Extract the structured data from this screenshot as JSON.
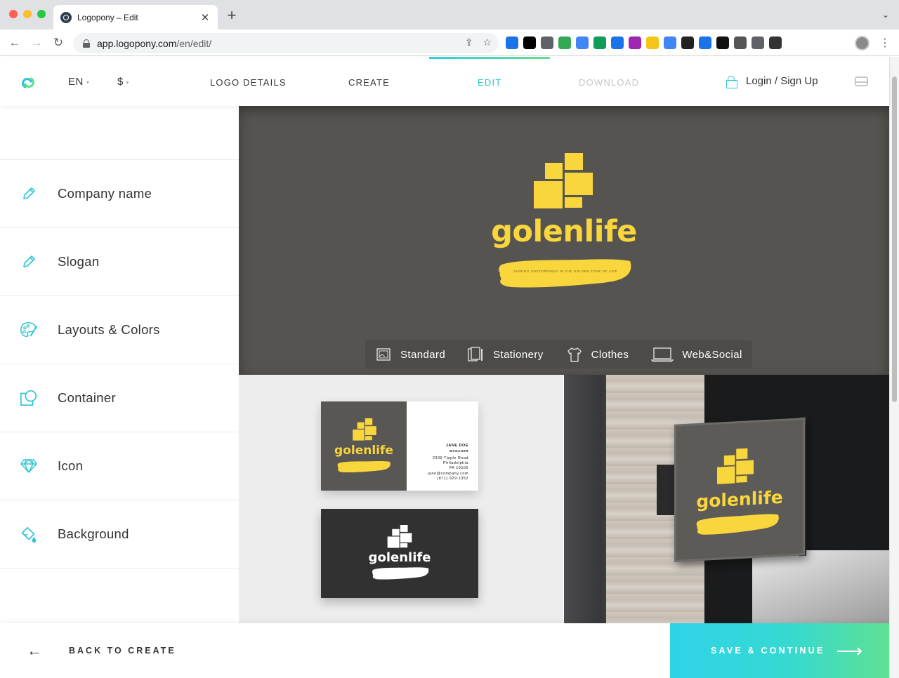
{
  "browser": {
    "tab_title": "Logopony – Edit",
    "tab_close": "✕",
    "new_tab": "+",
    "tab_menu": "⌄",
    "url_host": "app.logopony.com",
    "url_path": "/en/edit/",
    "back": "←",
    "forward": "→",
    "reload": "↻",
    "share": "⇪",
    "star": "☆",
    "kebab": "⋮",
    "extension_colors": [
      "#1a73e8",
      "#000000",
      "#5f6368",
      "#34a853",
      "#4285f4",
      "#0f9d58",
      "#1a73e8",
      "#9c27b0",
      "#f5c518",
      "#4285f4",
      "#222222",
      "#1a73e8",
      "#111111",
      "#555555",
      "#5f6368",
      "#333333"
    ]
  },
  "header": {
    "language": "EN",
    "currency": "$",
    "caret": "▾",
    "steps": [
      {
        "label": "LOGO DETAILS",
        "state": "done"
      },
      {
        "label": "CREATE",
        "state": "done"
      },
      {
        "label": "EDIT",
        "state": "active"
      },
      {
        "label": "DOWNLOAD",
        "state": "disabled"
      }
    ],
    "login_label": "Login / Sign Up",
    "accent_color": "#2cc5d2"
  },
  "sidebar": {
    "items": [
      {
        "label": "Company name",
        "icon": "pencil-icon"
      },
      {
        "label": "Slogan",
        "icon": "pencil-icon"
      },
      {
        "label": "Layouts & Colors",
        "icon": "palette-icon"
      },
      {
        "label": "Container",
        "icon": "container-shape-icon"
      },
      {
        "label": "Icon",
        "icon": "diamond-icon"
      },
      {
        "label": "Background",
        "icon": "paint-bucket-icon"
      }
    ]
  },
  "preview": {
    "brand_name": "golenlife",
    "slogan": "SHINING UNSTOPPABLY IN THE GOLDEN TONE OF LIFE",
    "background_color": "#565451",
    "brand_color": "#fad63d",
    "mockup_tabs": [
      {
        "label": "Standard",
        "icon": "image-frame-icon"
      },
      {
        "label": "Stationery",
        "icon": "stationery-icon"
      },
      {
        "label": "Clothes",
        "icon": "tshirt-icon"
      },
      {
        "label": "Web&Social",
        "icon": "laptop-icon"
      }
    ],
    "business_card": {
      "name": "JANE DOE",
      "title": "MANAGER",
      "address_line1": "2339 Tipple Road",
      "address_line2": "Philadelphia",
      "address_line3": "PA 19100",
      "email": "jane@company.com",
      "phone": "(871) 929-1352"
    }
  },
  "footer": {
    "back_label": "BACK TO CREATE",
    "back_arrow": "←",
    "save_label": "SAVE & CONTINUE",
    "save_arrow": "⟶"
  }
}
